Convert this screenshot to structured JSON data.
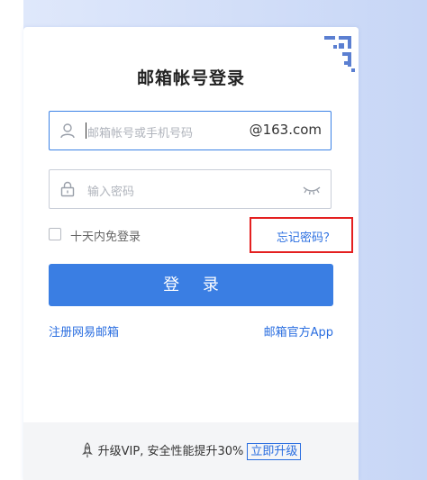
{
  "login": {
    "title": "邮箱帐号登录",
    "account_placeholder": "邮箱帐号或手机号码",
    "account_suffix": "@163.com",
    "password_placeholder": "输入密码",
    "remember_label": "十天内免登录",
    "forgot_label": "忘记密码？",
    "login_button": "登 录",
    "register_link": "注册网易邮箱",
    "official_app_link": "邮箱官方App"
  },
  "footer": {
    "promo_text": "升级VIP, 安全性能提升30%",
    "upgrade_button": "立即升级"
  },
  "colors": {
    "accent": "#3a7ee3",
    "link": "#2a6ee0",
    "highlight": "#e42020"
  },
  "icons": [
    "qr-code-icon",
    "user-icon",
    "lock-icon",
    "eye-closed-icon",
    "rocket-icon"
  ]
}
